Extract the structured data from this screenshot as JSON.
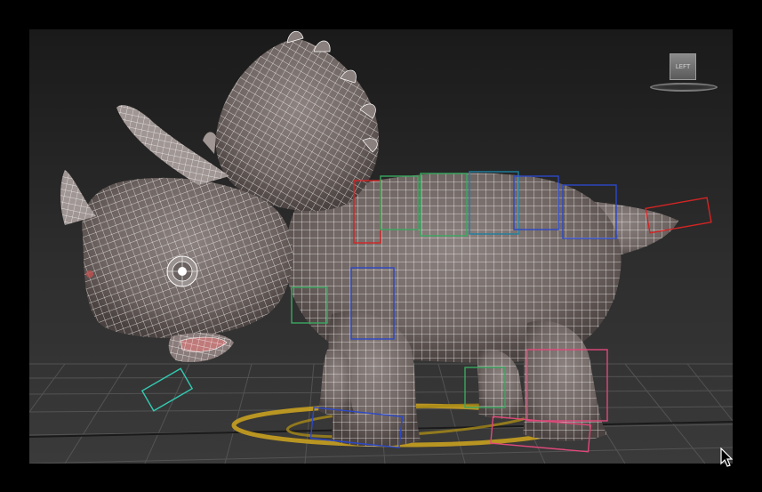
{
  "app": {
    "window_type": "3d-viewport",
    "background_color": "#000000",
    "viewport_color": "#2a2a2a",
    "grid_color": "#5a5a5a",
    "mesh_fill_color": "#7d7370",
    "wireframe_color": "#ffffff"
  },
  "viewport": {
    "viewcube_label": "LEFT",
    "viewcube_icon": "viewcube-icon",
    "model": "triceratops-wireframe-model",
    "rig_colors": {
      "cyan": "#33c9b0",
      "green": "#3aa860",
      "blue": "#2c48c8",
      "red": "#d42424",
      "pink": "#e0487a",
      "yellow": "#c8a020"
    }
  },
  "cursor": {
    "icon": "mouse-pointer-icon"
  }
}
